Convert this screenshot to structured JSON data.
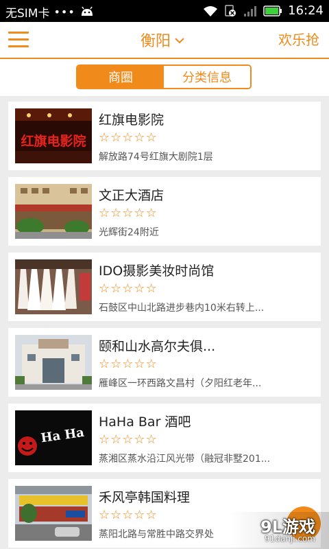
{
  "status_bar": {
    "carrier": "无SIM卡",
    "dots": "•••",
    "time": "16:24",
    "icons": [
      "android-icon",
      "wifi-icon",
      "no-sim-icon",
      "signal-icon",
      "battery-icon"
    ]
  },
  "nav": {
    "menu_icon": "hamburger-icon",
    "city": "衡阳",
    "city_icon": "chevron-down-icon",
    "right_link": "欢乐抢"
  },
  "tabs": [
    {
      "label": "商圈",
      "active": true
    },
    {
      "label": "分类信息",
      "active": false
    }
  ],
  "list": [
    {
      "title": "红旗电影院",
      "rating": 0,
      "address": "解放路74号红旗大剧院1层"
    },
    {
      "title": "文正大酒店",
      "rating": 0,
      "address": "光辉街24附近"
    },
    {
      "title": "IDO摄影美妆时尚馆",
      "rating": 0,
      "address": "石鼓区中山北路进步巷内10米右转上..."
    },
    {
      "title": "颐和山水高尔夫俱...",
      "rating": 0,
      "address": "雁峰区一环西路文昌村（夕阳红老年..."
    },
    {
      "title": "HaHa Bar 酒吧",
      "rating": 0,
      "address": "蒸湘区蒸水沿江风光带（融冠非墅201..."
    },
    {
      "title": "禾风亭韩国料理",
      "rating": 0,
      "address": "蒸阳北路与常胜中路交界处"
    }
  ],
  "thumb_text": {
    "cinema": "红旗电影院",
    "bar": "Ha Ha"
  },
  "watermark": {
    "main": "9L游戏",
    "sub": "91danji.com"
  },
  "colors": {
    "accent": "#f08a1a",
    "text": "#222222",
    "subtext": "#555555",
    "background": "#ececec"
  }
}
